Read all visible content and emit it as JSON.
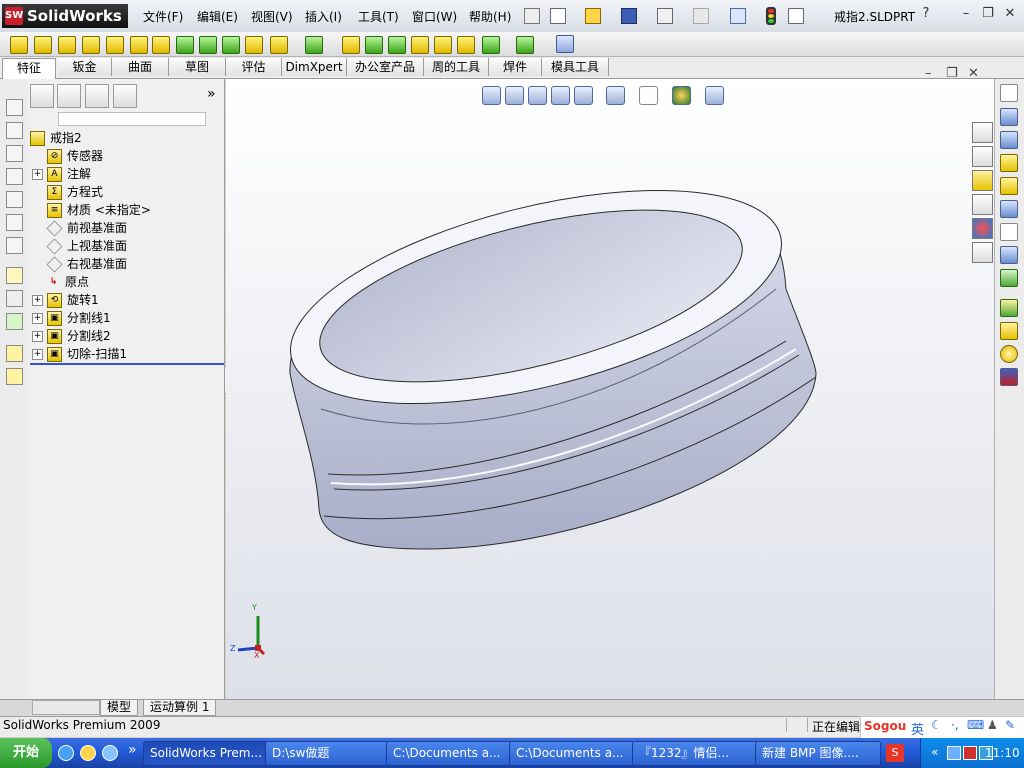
{
  "app": {
    "name": "SolidWorks",
    "logo_mark": "SW",
    "doc_title": "戒指2.SLDPRT"
  },
  "menus": [
    "文件(F)",
    "编辑(E)",
    "视图(V)",
    "插入(I)",
    "工具(T)",
    "窗口(W)",
    "帮助(H)"
  ],
  "help_glyph": "?",
  "tabs": [
    {
      "label": "特征",
      "active": true
    },
    {
      "label": "钣金"
    },
    {
      "label": "曲面"
    },
    {
      "label": "草图"
    },
    {
      "label": "评估"
    },
    {
      "label": "DimXpert"
    },
    {
      "label": "办公室产品"
    },
    {
      "label": "周的工具"
    },
    {
      "label": "焊件"
    },
    {
      "label": "模具工具"
    }
  ],
  "panel": {
    "expand_glyph": "»"
  },
  "tree": {
    "root": "戒指2",
    "items": [
      {
        "label": "传感器",
        "expander": false,
        "icon_text": "⊘"
      },
      {
        "label": "注解",
        "expander": true,
        "icon_text": "A"
      },
      {
        "label": "方程式",
        "expander": false,
        "icon_text": "Σ"
      },
      {
        "label": "材质 <未指定>",
        "expander": false,
        "icon_text": "≡"
      },
      {
        "label": "前视基准面",
        "expander": false,
        "icon_text": "",
        "plane": true
      },
      {
        "label": "上视基准面",
        "expander": false,
        "icon_text": "",
        "plane": true
      },
      {
        "label": "右视基准面",
        "expander": false,
        "icon_text": "",
        "plane": true
      },
      {
        "label": "原点",
        "expander": false,
        "icon_text": "↳",
        "origin": true
      },
      {
        "label": "旋转1",
        "expander": true,
        "icon_text": "⟲"
      },
      {
        "label": "分割线1",
        "expander": true,
        "icon_text": "▣"
      },
      {
        "label": "分割线2",
        "expander": true,
        "icon_text": "▣"
      },
      {
        "label": "切除-扫描1",
        "expander": true,
        "icon_text": "▣"
      }
    ]
  },
  "triad": {
    "x": "X",
    "y": "Y",
    "z": "Z"
  },
  "bottom_tabs": [
    "模型",
    "运动算例 1"
  ],
  "status": {
    "left": "SolidWorks Premium 2009",
    "right": "正在编辑"
  },
  "ime": {
    "label": "Sogou",
    "mode": "英"
  },
  "taskbar": {
    "start": "开始",
    "tasks": [
      {
        "label": "SolidWorks Prem...",
        "active": true
      },
      {
        "label": "D:\\sw做题"
      },
      {
        "label": "C:\\Documents a..."
      },
      {
        "label": "C:\\Documents a..."
      },
      {
        "label": "『1232』情侣..."
      },
      {
        "label": "新建 BMP 图像...."
      }
    ],
    "clock": "11:10"
  },
  "colors": {
    "viewport_top": "#ffffff",
    "viewport_bottom": "#dde0e8",
    "model_fill": "#c7cbdd",
    "model_shadow": "#9ea4bf",
    "rollback_bar": "#2b55c8",
    "taskbar": "#245edb",
    "start_button": "#2a9a2a"
  }
}
